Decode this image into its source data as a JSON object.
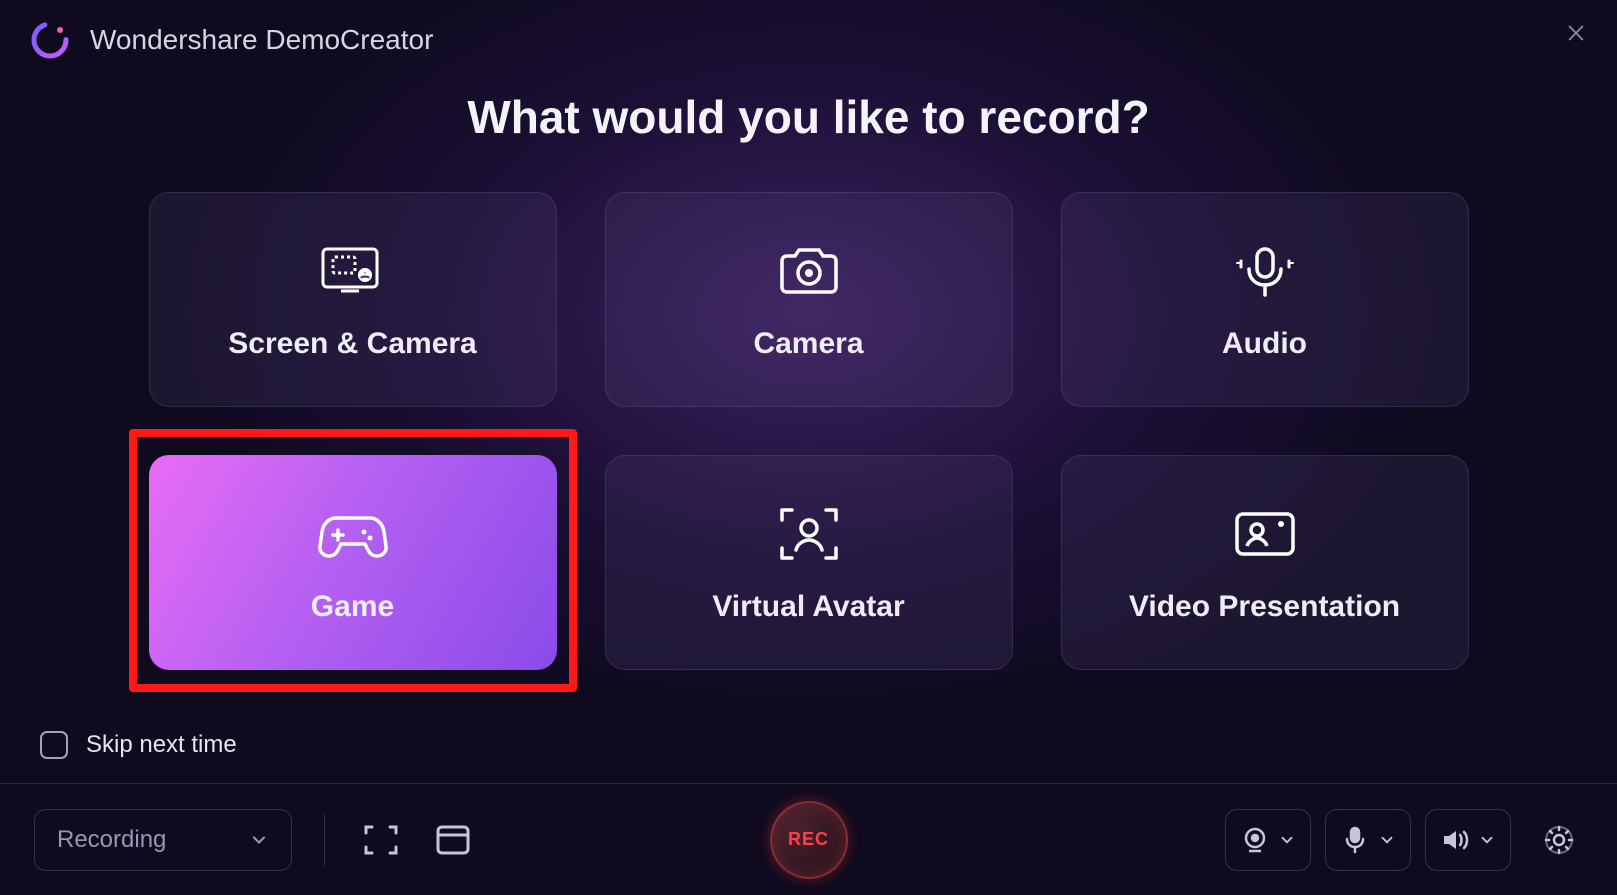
{
  "app": {
    "title": "Wondershare DemoCreator"
  },
  "heading": "What would you like to record?",
  "cards": [
    {
      "label": "Screen & Camera"
    },
    {
      "label": "Camera"
    },
    {
      "label": "Audio"
    },
    {
      "label": "Game"
    },
    {
      "label": "Virtual Avatar"
    },
    {
      "label": "Video Presentation"
    }
  ],
  "skip": {
    "label": "Skip next time"
  },
  "toolbar": {
    "mode": "Recording",
    "rec": "REC"
  }
}
